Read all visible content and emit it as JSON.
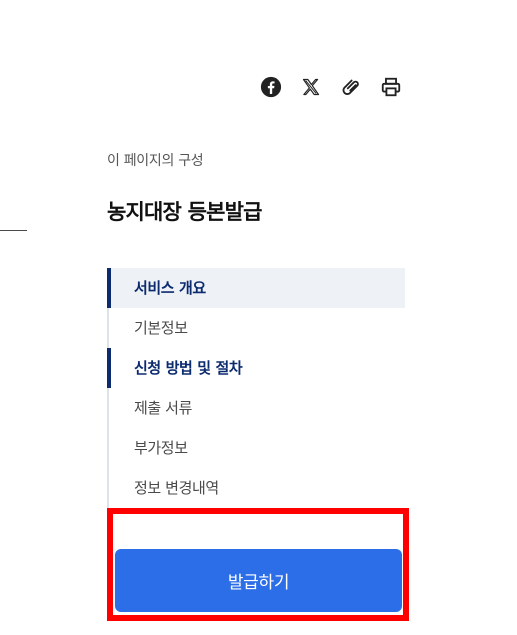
{
  "share": {
    "icons": [
      "facebook-icon",
      "x-icon",
      "link-icon",
      "print-icon"
    ]
  },
  "toc": {
    "caption": "이 페이지의 구성",
    "title": "농지대장 등본발급",
    "items": [
      {
        "label": "서비스 개요",
        "state": "active"
      },
      {
        "label": "기본정보",
        "state": "normal"
      },
      {
        "label": "신청 방법 및 절차",
        "state": "marked"
      },
      {
        "label": "제출 서류",
        "state": "normal"
      },
      {
        "label": "부가정보",
        "state": "normal"
      },
      {
        "label": "정보 변경내역",
        "state": "normal"
      }
    ]
  },
  "action": {
    "issue_label": "발급하기"
  },
  "colors": {
    "accent_navy": "#0b2b6e",
    "button_blue": "#2c6de8",
    "highlight_red": "#ff0000"
  }
}
